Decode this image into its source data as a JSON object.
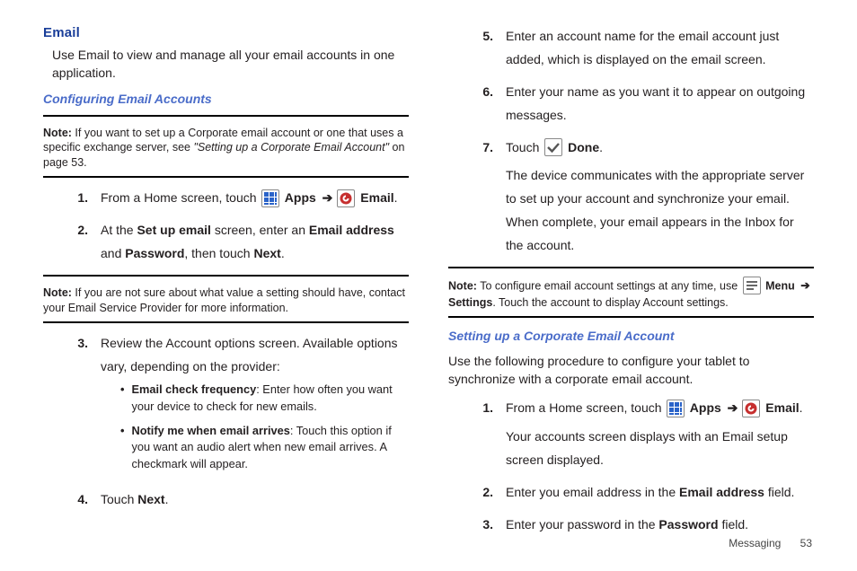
{
  "left": {
    "heading": "Email",
    "intro": "Use Email to view and manage all your email accounts in one application.",
    "subhead": "Configuring Email Accounts",
    "note1_label": "Note:",
    "note1_a": " If you want to set up a Corporate email account or one that uses a specific exchange server, see ",
    "note1_ital": "\"Setting up a Corporate Email Account\"",
    "note1_b": " on page 53.",
    "step1_num": "1.",
    "step1_a": "From a Home screen, touch ",
    "step1_apps": " Apps ",
    "step1_arrow": "➔",
    "step1_email": " Email",
    "step1_dot": ".",
    "step2_num": "2.",
    "step2_a": "At the ",
    "step2_b": "Set up email",
    "step2_c": " screen, enter an ",
    "step2_d": "Email address",
    "step2_e": " and ",
    "step2_f": "Password",
    "step2_g": ", then touch ",
    "step2_h": "Next",
    "step2_i": ".",
    "note2_label": "Note:",
    "note2_txt": " If you are not sure about what value a setting should have, contact your Email Service Provider for more information.",
    "step3_num": "3.",
    "step3_txt": "Review the Account options screen. Available options vary, depending on the provider:",
    "bullet1_b": "Email check frequency",
    "bullet1_t": ": Enter how often you want your device to check for new emails.",
    "bullet2_b": "Notify me when email arrives",
    "bullet2_t": ": Touch this option if you want an audio alert when new email arrives. A checkmark will appear.",
    "step4_num": "4.",
    "step4_a": "Touch ",
    "step4_b": "Next",
    "step4_c": "."
  },
  "right": {
    "step5_num": "5.",
    "step5_txt": "Enter an account name for the email account just added, which is displayed on the email screen.",
    "step6_num": "6.",
    "step6_txt": "Enter your name as you want it to appear on outgoing messages.",
    "step7_num": "7.",
    "step7_a": "Touch ",
    "step7_done": " Done",
    "step7_dot": ".",
    "step7_body": "The device communicates with the appropriate server to set up your account and synchronize your email. When complete, your email appears in the Inbox for the account.",
    "note_label": "Note:",
    "note_a": " To configure email account settings at any time, use ",
    "note_menu": " Menu ",
    "note_arrow": "➔",
    "note_settings": " Settings",
    "note_b": ". Touch the account to display Account settings.",
    "subhead": "Setting up a Corporate Email Account",
    "intro": "Use the following procedure to configure your tablet to synchronize with a corporate email account.",
    "c1_num": "1.",
    "c1_a": "From a Home screen, touch ",
    "c1_apps": " Apps ",
    "c1_arrow": "➔",
    "c1_email": " Email",
    "c1_dot": ".",
    "c1_body": "Your accounts screen displays with an Email setup screen displayed.",
    "c2_num": "2.",
    "c2_a": "Enter you email address in the ",
    "c2_b": "Email address",
    "c2_c": " field.",
    "c3_num": "3.",
    "c3_a": "Enter your password in the ",
    "c3_b": "Password",
    "c3_c": " field."
  },
  "footer": {
    "section": "Messaging",
    "page": "53"
  }
}
